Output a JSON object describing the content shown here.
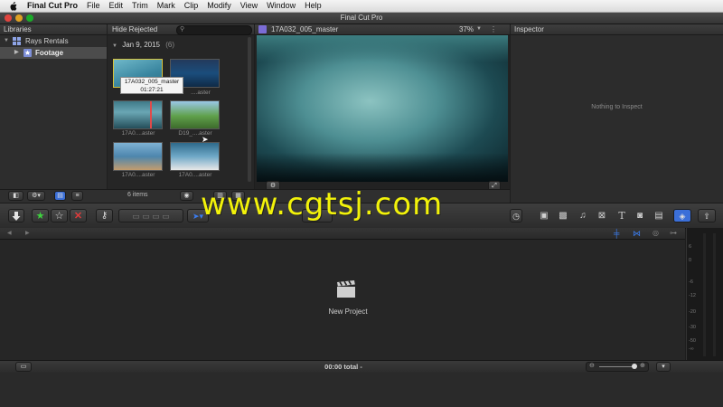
{
  "menubar": {
    "apple_glyph": "",
    "items": [
      "Final Cut Pro",
      "File",
      "Edit",
      "Trim",
      "Mark",
      "Clip",
      "Modify",
      "View",
      "Window",
      "Help"
    ]
  },
  "window": {
    "title": "Final Cut Pro"
  },
  "libraries": {
    "header": "Libraries",
    "library_name": "Rays Rentals",
    "event_name": "Footage"
  },
  "browser": {
    "filter": "Hide Rejected",
    "date_group": "Jan 9, 2015",
    "group_count": "(6)",
    "tooltip": {
      "name": "17A032_005_master",
      "duration": "01:27:21"
    },
    "clip_labels": [
      "17A0....aster",
      "D19_....aster",
      "17A0....aster",
      "17A0....aster"
    ],
    "tooltip_clip_label": "....aster",
    "items_count": "6 items"
  },
  "viewer": {
    "clip_name": "17A032_005_master",
    "zoom": "37%"
  },
  "inspector": {
    "header": "Inspector",
    "empty_message": "Nothing to Inspect"
  },
  "toolbar": {
    "import_icon": "import-arrow-icon",
    "title_glyph": "T"
  },
  "timeline": {
    "placeholder": "New Project",
    "total": "00:00 total -"
  },
  "meters": {
    "labels": [
      "6",
      "0",
      "-6",
      "-12",
      "-20",
      "-30",
      "-50",
      "-∞"
    ]
  },
  "watermark": "www.cgtsj.com",
  "colors": {
    "accent_blue": "#3b7df0",
    "star_green": "#3fd23f",
    "reject_red": "#e03b3b",
    "watermark_yellow": "#f2f20a"
  }
}
